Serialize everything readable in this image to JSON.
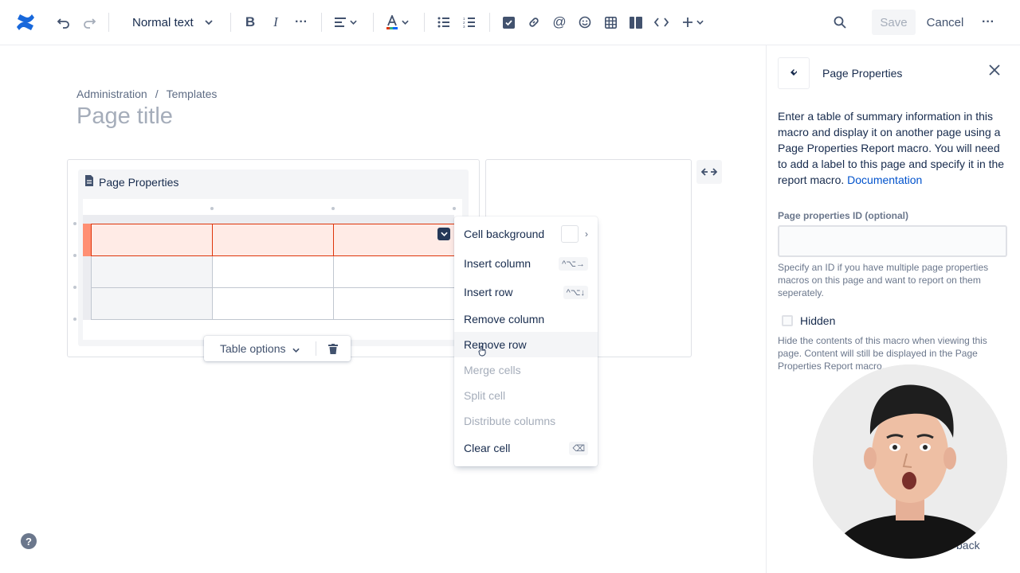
{
  "toolbar": {
    "text_style": "Normal text",
    "save_label": "Save",
    "cancel_label": "Cancel"
  },
  "breadcrumb": {
    "items": [
      "Administration",
      "Templates"
    ],
    "separator": "/"
  },
  "page": {
    "title_placeholder": "Page title"
  },
  "macro": {
    "label": "Page Properties"
  },
  "table_options": {
    "label": "Table options"
  },
  "context_menu": {
    "items": [
      {
        "label": "Cell background",
        "state": "enabled"
      },
      {
        "label": "Insert column",
        "shortcut": "^⌥→",
        "state": "enabled"
      },
      {
        "label": "Insert row",
        "shortcut": "^⌥↓",
        "state": "enabled"
      },
      {
        "label": "Remove column",
        "state": "enabled"
      },
      {
        "label": "Remove row",
        "state": "hover"
      },
      {
        "label": "Merge cells",
        "state": "disabled"
      },
      {
        "label": "Split cell",
        "state": "disabled"
      },
      {
        "label": "Distribute columns",
        "state": "disabled"
      },
      {
        "label": "Clear cell",
        "shortcut": "⌫",
        "state": "enabled"
      }
    ]
  },
  "sidebar": {
    "title": "Page Properties",
    "description": "Enter a table of summary information in this macro and display it on another page using a Page Properties Report macro. You will need to add a label to this page and specify it in the report macro.",
    "doc_link": "Documentation",
    "id_label": "Page properties ID (optional)",
    "id_value": "",
    "id_help": "Specify an ID if you have multiple page properties macros on this page and want to report on them seperately.",
    "hidden_label": "Hidden",
    "hidden_checked": false,
    "hidden_help": "Hide the contents of this macro when viewing this page. Content will still be displayed in the Page Properties Report macro.",
    "feedback_partial": "back"
  },
  "help": {
    "label": "?"
  },
  "colors": {
    "accent": "#0052cc",
    "selection_border": "#de350b",
    "selection_fill": "#ffebe6",
    "brand": "#1868db"
  }
}
